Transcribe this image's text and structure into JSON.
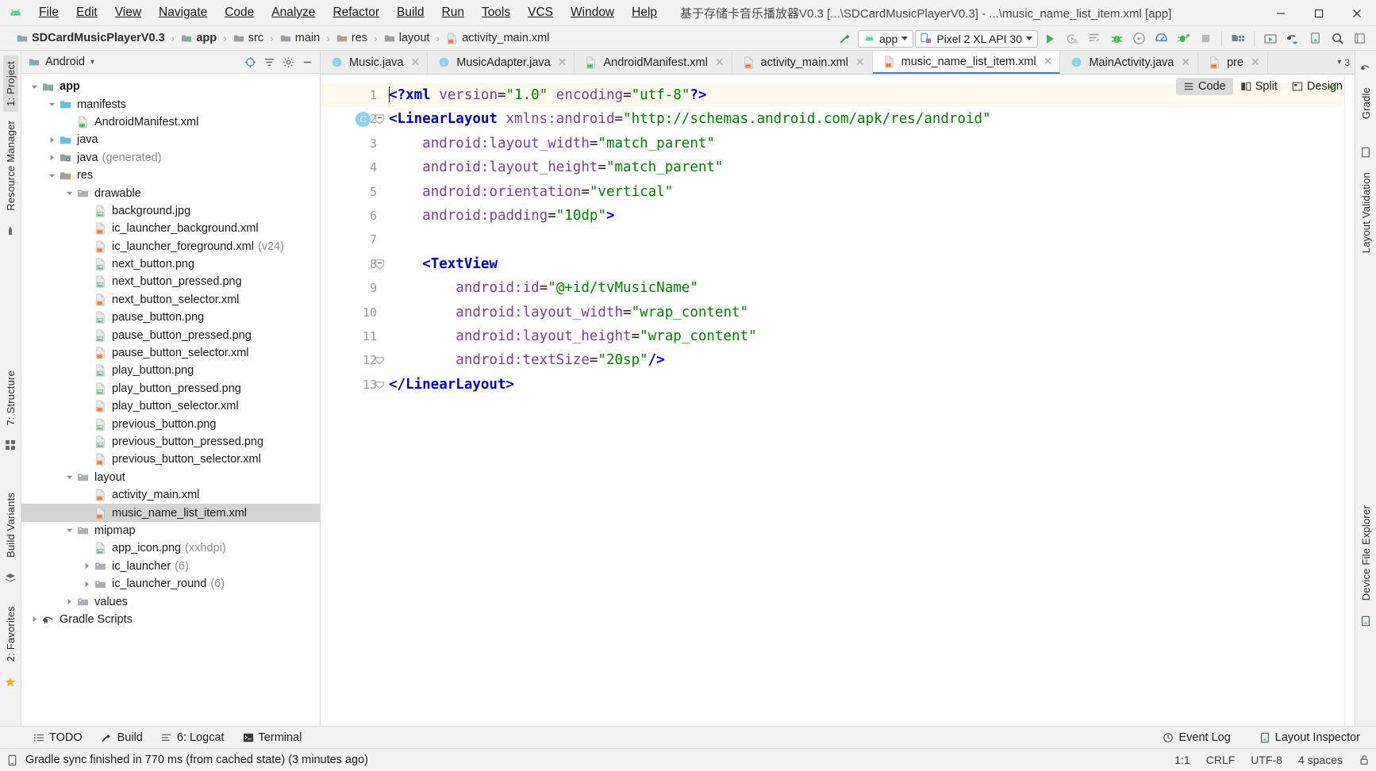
{
  "window": {
    "title": "基于存储卡音乐播放器V0.3 [...\\SDCardMusicPlayerV0.3] - ...\\music_name_list_item.xml [app]",
    "minimize": "—",
    "maximize": "▢",
    "close": "✕",
    "logo_icon": "android-logo-icon"
  },
  "menubar": {
    "items": [
      {
        "label": "File"
      },
      {
        "label": "Edit"
      },
      {
        "label": "View"
      },
      {
        "label": "Navigate"
      },
      {
        "label": "Code"
      },
      {
        "label": "Analyze"
      },
      {
        "label": "Refactor"
      },
      {
        "label": "Build"
      },
      {
        "label": "Run"
      },
      {
        "label": "Tools"
      },
      {
        "label": "VCS"
      },
      {
        "label": "Window"
      },
      {
        "label": "Help"
      }
    ]
  },
  "navbar": {
    "breadcrumbs": [
      {
        "label": "SDCardMusicPlayerV0.3",
        "icon": "project-folder-icon",
        "bold": true
      },
      {
        "label": "app",
        "icon": "module-folder-icon",
        "bold": true
      },
      {
        "label": "src",
        "icon": "folder-icon",
        "bold": false
      },
      {
        "label": "main",
        "icon": "folder-icon",
        "bold": false
      },
      {
        "label": "res",
        "icon": "res-folder-icon",
        "bold": false
      },
      {
        "label": "layout",
        "icon": "folder-icon",
        "bold": false
      },
      {
        "label": "activity_main.xml",
        "icon": "xml-layout-file-icon",
        "bold": false
      }
    ],
    "separator": "›",
    "run_config": "app",
    "device": "Pixel 2 XL API 30",
    "buttons": [
      {
        "name": "make-project-button",
        "icon": "hammer-icon"
      },
      {
        "name": "run-button",
        "icon": "play-triangle-icon"
      },
      {
        "name": "apply-changes-button",
        "icon": "apply-changes-icon"
      },
      {
        "name": "apply-code-changes-button",
        "icon": "apply-code-changes-icon"
      },
      {
        "name": "debug-button",
        "icon": "bug-icon"
      },
      {
        "name": "run-coverage-button",
        "icon": "coverage-icon"
      },
      {
        "name": "profiler-button",
        "icon": "profiler-icon"
      },
      {
        "name": "attach-debugger-button",
        "icon": "attach-debugger-icon"
      },
      {
        "name": "stop-button",
        "icon": "stop-square-icon"
      },
      {
        "name": "sdk-manager-button",
        "icon": "sdk-manager-icon"
      },
      {
        "name": "avd-manager-button",
        "icon": "avd-manager-icon"
      },
      {
        "name": "layout-inspector-button",
        "icon": "layout-inspector-icon"
      },
      {
        "name": "device-file-explorer-button",
        "icon": "device-explorer-icon"
      },
      {
        "name": "search-everywhere-button",
        "icon": "search-icon"
      },
      {
        "name": "more-button",
        "icon": "kebab-icon"
      }
    ]
  },
  "left_rail": {
    "tabs": [
      {
        "label": "1: Project",
        "selected": true,
        "name": "tool-window-project"
      },
      {
        "label": "Resource Manager",
        "selected": false,
        "name": "tool-window-resource-manager"
      },
      {
        "label": "7: Structure",
        "selected": false,
        "name": "tool-window-structure"
      },
      {
        "label": "Build Variants",
        "selected": false,
        "name": "tool-window-build-variants"
      },
      {
        "label": "2: Favorites",
        "selected": false,
        "name": "tool-window-favorites"
      }
    ]
  },
  "right_rail": {
    "tabs": [
      {
        "label": "Gradle",
        "name": "tool-window-gradle"
      },
      {
        "label": "Layout Validation",
        "name": "tool-window-layout-validation"
      },
      {
        "label": "Device File Explorer",
        "name": "tool-window-device-file-explorer"
      }
    ]
  },
  "project_panel": {
    "title": "Android",
    "title_caret": "▾",
    "tree": [
      {
        "indent": 0,
        "arrow": "down",
        "icon": "module-folder-icon",
        "label": "app",
        "bold": true,
        "suffix": "",
        "selected": false
      },
      {
        "indent": 1,
        "arrow": "down",
        "icon": "folder-blue-icon",
        "label": "manifests",
        "bold": false,
        "suffix": "",
        "selected": false
      },
      {
        "indent": 2,
        "arrow": "none",
        "icon": "manifest-file-icon",
        "label": "AndroidManifest.xml",
        "bold": false,
        "suffix": "",
        "selected": false
      },
      {
        "indent": 1,
        "arrow": "right",
        "icon": "folder-blue-icon",
        "label": "java",
        "bold": false,
        "suffix": "",
        "selected": false
      },
      {
        "indent": 1,
        "arrow": "right",
        "icon": "generated-folder-icon",
        "label": "java",
        "bold": false,
        "suffix": "(generated)",
        "selected": false
      },
      {
        "indent": 1,
        "arrow": "down",
        "icon": "res-folder-icon",
        "label": "res",
        "bold": false,
        "suffix": "",
        "selected": false
      },
      {
        "indent": 2,
        "arrow": "down",
        "icon": "folder-gray-icon",
        "label": "drawable",
        "bold": false,
        "suffix": "",
        "selected": false
      },
      {
        "indent": 3,
        "arrow": "none",
        "icon": "image-file-icon",
        "label": "background.jpg",
        "bold": false,
        "suffix": "",
        "selected": false
      },
      {
        "indent": 3,
        "arrow": "none",
        "icon": "xml-layout-file-icon",
        "label": "ic_launcher_background.xml",
        "bold": false,
        "suffix": "",
        "selected": false
      },
      {
        "indent": 3,
        "arrow": "none",
        "icon": "xml-layout-file-icon",
        "label": "ic_launcher_foreground.xml",
        "bold": false,
        "suffix": "(v24)",
        "selected": false
      },
      {
        "indent": 3,
        "arrow": "none",
        "icon": "image-file-icon",
        "label": "next_button.png",
        "bold": false,
        "suffix": "",
        "selected": false
      },
      {
        "indent": 3,
        "arrow": "none",
        "icon": "image-file-icon",
        "label": "next_button_pressed.png",
        "bold": false,
        "suffix": "",
        "selected": false
      },
      {
        "indent": 3,
        "arrow": "none",
        "icon": "xml-layout-file-icon",
        "label": "next_button_selector.xml",
        "bold": false,
        "suffix": "",
        "selected": false
      },
      {
        "indent": 3,
        "arrow": "none",
        "icon": "image-file-icon",
        "label": "pause_button.png",
        "bold": false,
        "suffix": "",
        "selected": false
      },
      {
        "indent": 3,
        "arrow": "none",
        "icon": "image-file-icon",
        "label": "pause_button_pressed.png",
        "bold": false,
        "suffix": "",
        "selected": false
      },
      {
        "indent": 3,
        "arrow": "none",
        "icon": "xml-layout-file-icon",
        "label": "pause_button_selector.xml",
        "bold": false,
        "suffix": "",
        "selected": false
      },
      {
        "indent": 3,
        "arrow": "none",
        "icon": "image-file-icon",
        "label": "play_button.png",
        "bold": false,
        "suffix": "",
        "selected": false
      },
      {
        "indent": 3,
        "arrow": "none",
        "icon": "image-file-icon",
        "label": "play_button_pressed.png",
        "bold": false,
        "suffix": "",
        "selected": false
      },
      {
        "indent": 3,
        "arrow": "none",
        "icon": "xml-layout-file-icon",
        "label": "play_button_selector.xml",
        "bold": false,
        "suffix": "",
        "selected": false
      },
      {
        "indent": 3,
        "arrow": "none",
        "icon": "image-file-icon",
        "label": "previous_button.png",
        "bold": false,
        "suffix": "",
        "selected": false
      },
      {
        "indent": 3,
        "arrow": "none",
        "icon": "image-file-icon",
        "label": "previous_button_pressed.png",
        "bold": false,
        "suffix": "",
        "selected": false
      },
      {
        "indent": 3,
        "arrow": "none",
        "icon": "xml-layout-file-icon",
        "label": "previous_button_selector.xml",
        "bold": false,
        "suffix": "",
        "selected": false
      },
      {
        "indent": 2,
        "arrow": "down",
        "icon": "folder-gray-icon",
        "label": "layout",
        "bold": false,
        "suffix": "",
        "selected": false
      },
      {
        "indent": 3,
        "arrow": "none",
        "icon": "xml-layout-file-icon",
        "label": "activity_main.xml",
        "bold": false,
        "suffix": "",
        "selected": false
      },
      {
        "indent": 3,
        "arrow": "none",
        "icon": "xml-layout-file-icon",
        "label": "music_name_list_item.xml",
        "bold": false,
        "suffix": "",
        "selected": true
      },
      {
        "indent": 2,
        "arrow": "down",
        "icon": "folder-gray-icon",
        "label": "mipmap",
        "bold": false,
        "suffix": "",
        "selected": false
      },
      {
        "indent": 3,
        "arrow": "none",
        "icon": "image-file-icon",
        "label": "app_icon.png",
        "bold": false,
        "suffix": "(xxhdpi)",
        "selected": false
      },
      {
        "indent": 3,
        "arrow": "right",
        "icon": "folder-gray-icon",
        "label": "ic_launcher",
        "bold": false,
        "suffix": "(6)",
        "selected": false
      },
      {
        "indent": 3,
        "arrow": "right",
        "icon": "folder-gray-icon",
        "label": "ic_launcher_round",
        "bold": false,
        "suffix": "(6)",
        "selected": false
      },
      {
        "indent": 2,
        "arrow": "right",
        "icon": "folder-gray-icon",
        "label": "values",
        "bold": false,
        "suffix": "",
        "selected": false
      },
      {
        "indent": 0,
        "arrow": "right",
        "icon": "gradle-elephant-icon",
        "label": "Gradle Scripts",
        "bold": false,
        "suffix": "",
        "selected": false
      }
    ]
  },
  "editor": {
    "tabs": [
      {
        "label": "Music.java",
        "icon": "java-class-icon",
        "active": false,
        "close": "✕"
      },
      {
        "label": "MusicAdapter.java",
        "icon": "java-class-icon",
        "active": false,
        "close": "✕"
      },
      {
        "label": "AndroidManifest.xml",
        "icon": "manifest-file-icon",
        "active": false,
        "close": "✕"
      },
      {
        "label": "activity_main.xml",
        "icon": "xml-layout-file-icon",
        "active": false,
        "close": "✕"
      },
      {
        "label": "music_name_list_item.xml",
        "icon": "xml-layout-file-icon",
        "active": true,
        "close": "✕"
      },
      {
        "label": "MainActivity.java",
        "icon": "java-class-icon",
        "active": false,
        "close": "✕"
      },
      {
        "label": "pre",
        "icon": "xml-layout-file-icon",
        "active": false,
        "close": "✕"
      }
    ],
    "tab_overflow": "3",
    "view_modes": [
      {
        "label": "Code",
        "icon": "code-view-icon",
        "active": true
      },
      {
        "label": "Split",
        "icon": "split-view-icon",
        "active": false
      },
      {
        "label": "Design",
        "icon": "design-view-icon",
        "active": false
      }
    ],
    "lines": [
      {
        "n": "1",
        "current": true,
        "gutter_badge": "",
        "fold": "",
        "tokens": [
          {
            "t": "caret",
            "v": ""
          },
          {
            "t": "pi",
            "v": "<?xml"
          },
          {
            "t": "plain",
            "v": " "
          },
          {
            "t": "attr",
            "v": "version"
          },
          {
            "t": "eq",
            "v": "="
          },
          {
            "t": "str",
            "v": "\"1.0\""
          },
          {
            "t": "plain",
            "v": " "
          },
          {
            "t": "attr",
            "v": "encoding"
          },
          {
            "t": "eq",
            "v": "="
          },
          {
            "t": "str",
            "v": "\"utf-8\""
          },
          {
            "t": "pi",
            "v": "?>"
          }
        ]
      },
      {
        "n": "2",
        "current": false,
        "gutter_badge": "C",
        "fold": "minus",
        "tokens": [
          {
            "t": "tag",
            "v": "<LinearLayout"
          },
          {
            "t": "plain",
            "v": " "
          },
          {
            "t": "ns",
            "v": "xmlns:android"
          },
          {
            "t": "eq",
            "v": "="
          },
          {
            "t": "str",
            "v": "\"http://schemas.android.com/apk/res/android\""
          }
        ]
      },
      {
        "n": "3",
        "current": false,
        "gutter_badge": "",
        "fold": "",
        "tokens": [
          {
            "t": "plain",
            "v": "    "
          },
          {
            "t": "attr",
            "v": "android:layout_width"
          },
          {
            "t": "eq",
            "v": "="
          },
          {
            "t": "str",
            "v": "\"match_parent\""
          }
        ]
      },
      {
        "n": "4",
        "current": false,
        "gutter_badge": "",
        "fold": "",
        "tokens": [
          {
            "t": "plain",
            "v": "    "
          },
          {
            "t": "attr",
            "v": "android:layout_height"
          },
          {
            "t": "eq",
            "v": "="
          },
          {
            "t": "str",
            "v": "\"match_parent\""
          }
        ]
      },
      {
        "n": "5",
        "current": false,
        "gutter_badge": "",
        "fold": "",
        "tokens": [
          {
            "t": "plain",
            "v": "    "
          },
          {
            "t": "attr",
            "v": "android:orientation"
          },
          {
            "t": "eq",
            "v": "="
          },
          {
            "t": "str",
            "v": "\"vertical\""
          }
        ]
      },
      {
        "n": "6",
        "current": false,
        "gutter_badge": "",
        "fold": "",
        "tokens": [
          {
            "t": "plain",
            "v": "    "
          },
          {
            "t": "attr",
            "v": "android:padding"
          },
          {
            "t": "eq",
            "v": "="
          },
          {
            "t": "str",
            "v": "\"10dp\""
          },
          {
            "t": "tag",
            "v": ">"
          }
        ]
      },
      {
        "n": "7",
        "current": false,
        "gutter_badge": "",
        "fold": "",
        "tokens": []
      },
      {
        "n": "8",
        "current": false,
        "gutter_badge": "",
        "fold": "minus",
        "tokens": [
          {
            "t": "plain",
            "v": "    "
          },
          {
            "t": "tag",
            "v": "<TextView"
          }
        ]
      },
      {
        "n": "9",
        "current": false,
        "gutter_badge": "",
        "fold": "",
        "tokens": [
          {
            "t": "plain",
            "v": "        "
          },
          {
            "t": "attr",
            "v": "android:id"
          },
          {
            "t": "eq",
            "v": "="
          },
          {
            "t": "str",
            "v": "\"@+id/tvMusicName\""
          }
        ]
      },
      {
        "n": "10",
        "current": false,
        "gutter_badge": "",
        "fold": "",
        "tokens": [
          {
            "t": "plain",
            "v": "        "
          },
          {
            "t": "attr",
            "v": "android:layout_width"
          },
          {
            "t": "eq",
            "v": "="
          },
          {
            "t": "str",
            "v": "\"wrap_content\""
          }
        ]
      },
      {
        "n": "11",
        "current": false,
        "gutter_badge": "",
        "fold": "",
        "tokens": [
          {
            "t": "plain",
            "v": "        "
          },
          {
            "t": "attr",
            "v": "android:layout_height"
          },
          {
            "t": "eq",
            "v": "="
          },
          {
            "t": "str",
            "v": "\"wrap_content\""
          }
        ]
      },
      {
        "n": "12",
        "current": false,
        "gutter_badge": "",
        "fold": "end",
        "tokens": [
          {
            "t": "plain",
            "v": "        "
          },
          {
            "t": "attr",
            "v": "android:textSize"
          },
          {
            "t": "eq",
            "v": "="
          },
          {
            "t": "str",
            "v": "\"20sp\""
          },
          {
            "t": "tag",
            "v": "/>"
          }
        ]
      },
      {
        "n": "13",
        "current": false,
        "gutter_badge": "",
        "fold": "end",
        "tokens": [
          {
            "t": "tag",
            "v": "</LinearLayout>"
          }
        ]
      }
    ],
    "inspection_ok_icon": "checkmark-icon"
  },
  "bottom_bar": {
    "buttons": [
      {
        "label": "TODO",
        "icon": "todo-list-icon"
      },
      {
        "label": "Build",
        "icon": "hammer-icon"
      },
      {
        "label": "6: Logcat",
        "icon": "logcat-icon"
      },
      {
        "label": "Terminal",
        "icon": "terminal-icon"
      }
    ],
    "right": [
      {
        "label": "Event Log",
        "icon": "event-log-icon"
      },
      {
        "label": "Layout Inspector",
        "icon": "layout-inspector-icon"
      }
    ]
  },
  "status_bar": {
    "message": "Gradle sync finished in 770 ms (from cached state) (3 minutes ago)",
    "message_icon": "info-phone-icon",
    "caret_position": "1:1",
    "line_separator": "CRLF",
    "encoding": "UTF-8",
    "indent": "4 spaces",
    "lock_icon": "lock-open-icon"
  },
  "colors": {
    "accent_blue": "#4083c9",
    "green": "#3ddc84",
    "tag_blue": "#0000c8",
    "attr_purple": "#7a3e9d",
    "string_green": "#008000",
    "selection_gray": "#d4d4d4",
    "current_line": "#fcfaed"
  }
}
